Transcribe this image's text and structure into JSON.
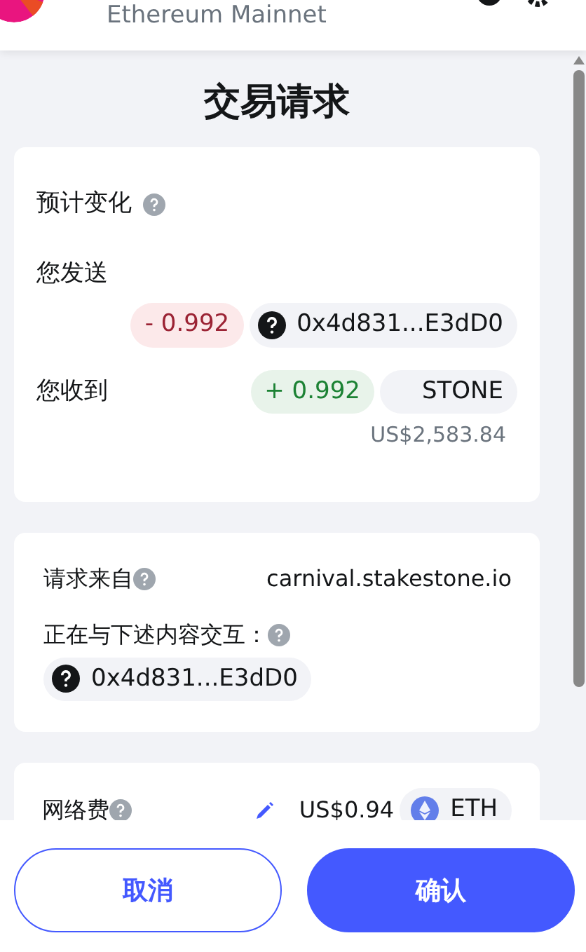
{
  "header": {
    "network": "Ethereum Mainnet"
  },
  "title": "交易请求",
  "balance_changes": {
    "heading": "预计变化",
    "rows": [
      {
        "label": "您发送",
        "kind": "out",
        "amount": "- 0.992",
        "token": "0x4d831...E3dD0",
        "icon": true
      },
      {
        "label": "您收到",
        "kind": "in",
        "amount": "+ 0.992",
        "token": "STONE",
        "icon": false,
        "fiat": "US$2,583.84"
      }
    ]
  },
  "request": {
    "label": "请求来自",
    "origin": "carnival.stakestone.io",
    "interacting_label": "正在与下述内容交互：",
    "contract": "0x4d831...E3dD0"
  },
  "fee": {
    "label": "网络费",
    "amount": "US$0.94",
    "token": "ETH"
  },
  "buttons": [
    {
      "label": "取消",
      "kind": "secondary"
    },
    {
      "label": "确认",
      "kind": "primary"
    }
  ]
}
